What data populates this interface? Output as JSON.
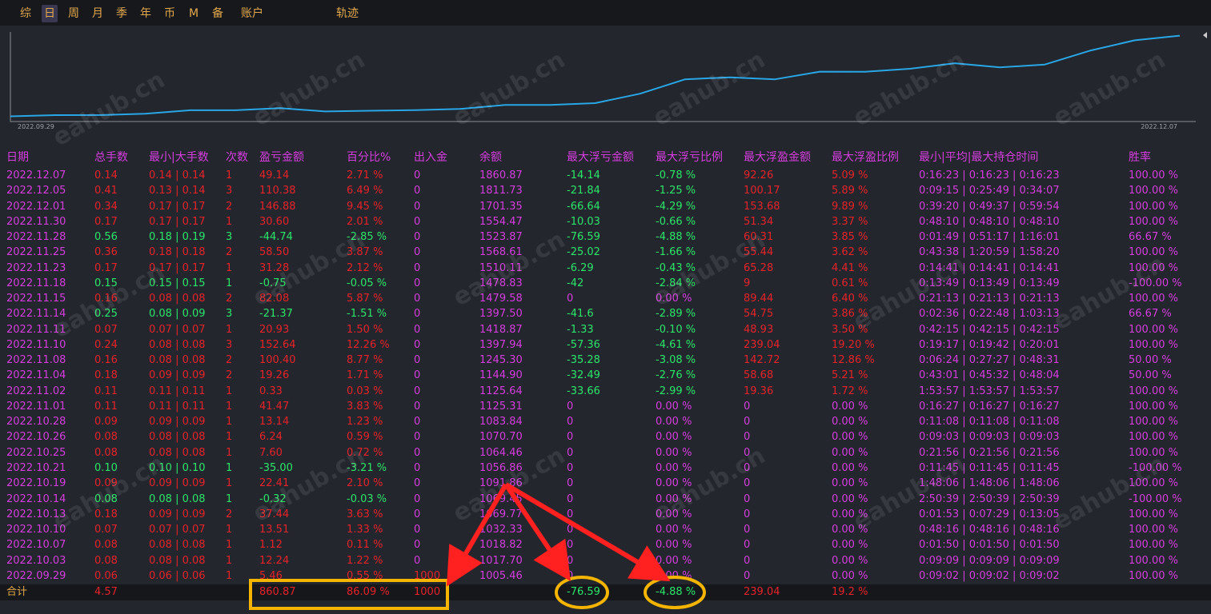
{
  "tabs": [
    "综",
    "日",
    "周",
    "月",
    "季",
    "年",
    "币",
    "M",
    "备",
    "账户",
    "轨迹"
  ],
  "active_tab": "日",
  "colors": {
    "background": "#23262c",
    "line": "#29a6e6",
    "magenta": "#d63de0",
    "red": "#e8222a",
    "green": "#2ce66b",
    "orange": "#e3a94d",
    "annotation": "#f5b400",
    "arrow": "#ff2020"
  },
  "equity_chart": {
    "type": "line",
    "x_start_label": "2022.09.29",
    "x_end_label": "2022.12.07",
    "x": [
      "2022.09.29",
      "2022.10.03",
      "2022.10.07",
      "2022.10.10",
      "2022.10.13",
      "2022.10.14",
      "2022.10.19",
      "2022.10.21",
      "2022.10.25",
      "2022.10.26",
      "2022.10.28",
      "2022.11.01",
      "2022.11.02",
      "2022.11.04",
      "2022.11.08",
      "2022.11.10",
      "2022.11.11",
      "2022.11.14",
      "2022.11.15",
      "2022.11.18",
      "2022.11.23",
      "2022.11.25",
      "2022.11.28",
      "2022.11.30",
      "2022.12.01",
      "2022.12.05",
      "2022.12.07"
    ],
    "values": [
      1005.46,
      1017.7,
      1018.82,
      1032.33,
      1069.77,
      1069.45,
      1091.86,
      1056.86,
      1064.46,
      1070.7,
      1083.84,
      1125.31,
      1125.64,
      1144.9,
      1245.3,
      1397.94,
      1418.87,
      1397.5,
      1479.58,
      1478.83,
      1510.11,
      1568.61,
      1523.87,
      1554.47,
      1701.35,
      1811.73,
      1860.87
    ],
    "ylim": [
      950,
      1900
    ]
  },
  "headers": [
    "日期",
    "总手数",
    "最小|大手数",
    "次数",
    "盈亏金额",
    "百分比%",
    "出入金",
    "余额",
    "最大浮亏金额",
    "最大浮亏比例",
    "最大浮盈金额",
    "最大浮盈比例",
    "最小|平均|最大持仓时间",
    "胜率"
  ],
  "rows": [
    [
      "2022.12.07",
      "0.14",
      "0.14 | 0.14",
      "1",
      "49.14",
      "2.71 %",
      "0",
      "1860.87",
      "-14.14",
      "-0.78 %",
      "92.26",
      "5.09 %",
      "0:16:23 | 0:16:23 | 0:16:23",
      "100.00 %"
    ],
    [
      "2022.12.05",
      "0.41",
      "0.13 | 0.14",
      "3",
      "110.38",
      "6.49 %",
      "0",
      "1811.73",
      "-21.84",
      "-1.25 %",
      "100.17",
      "5.89 %",
      "0:09:15 | 0:25:49 | 0:34:07",
      "100.00 %"
    ],
    [
      "2022.12.01",
      "0.34",
      "0.17 | 0.17",
      "2",
      "146.88",
      "9.45 %",
      "0",
      "1701.35",
      "-66.64",
      "-4.29 %",
      "153.68",
      "9.89 %",
      "0:39:20 | 0:49:37 | 0:59:54",
      "100.00 %"
    ],
    [
      "2022.11.30",
      "0.17",
      "0.17 | 0.17",
      "1",
      "30.60",
      "2.01 %",
      "0",
      "1554.47",
      "-10.03",
      "-0.66 %",
      "51.34",
      "3.37 %",
      "0:48:10 | 0:48:10 | 0:48:10",
      "100.00 %"
    ],
    [
      "2022.11.28",
      "0.56",
      "0.18 | 0.19",
      "3",
      "-44.74",
      "-2.85 %",
      "0",
      "1523.87",
      "-76.59",
      "-4.88 %",
      "60.31",
      "3.85 %",
      "0:01:49 | 0:51:17 | 1:16:01",
      "66.67 %"
    ],
    [
      "2022.11.25",
      "0.36",
      "0.18 | 0.18",
      "2",
      "58.50",
      "3.87 %",
      "0",
      "1568.61",
      "-25.02",
      "-1.66 %",
      "55.44",
      "3.62 %",
      "0:43:38 | 1:20:59 | 1:58:20",
      "100.00 %"
    ],
    [
      "2022.11.23",
      "0.17",
      "0.17 | 0.17",
      "1",
      "31.28",
      "2.12 %",
      "0",
      "1510.11",
      "-6.29",
      "-0.43 %",
      "65.28",
      "4.41 %",
      "0:14:41 | 0:14:41 | 0:14:41",
      "100.00 %"
    ],
    [
      "2022.11.18",
      "0.15",
      "0.15 | 0.15",
      "1",
      "-0.75",
      "-0.05 %",
      "0",
      "1478.83",
      "-42",
      "-2.84 %",
      "9",
      "0.61 %",
      "0:13:49 | 0:13:49 | 0:13:49",
      "-100.00 %"
    ],
    [
      "2022.11.15",
      "0.16",
      "0.08 | 0.08",
      "2",
      "82.08",
      "5.87 %",
      "0",
      "1479.58",
      "0",
      "0.00 %",
      "89.44",
      "6.40 %",
      "0:21:13 | 0:21:13 | 0:21:13",
      "100.00 %"
    ],
    [
      "2022.11.14",
      "0.25",
      "0.08 | 0.09",
      "3",
      "-21.37",
      "-1.51 %",
      "0",
      "1397.50",
      "-41.6",
      "-2.89 %",
      "54.75",
      "3.86 %",
      "0:02:36 | 0:22:48 | 1:03:13",
      "66.67 %"
    ],
    [
      "2022.11.11",
      "0.07",
      "0.07 | 0.07",
      "1",
      "20.93",
      "1.50 %",
      "0",
      "1418.87",
      "-1.33",
      "-0.10 %",
      "48.93",
      "3.50 %",
      "0:42:15 | 0:42:15 | 0:42:15",
      "100.00 %"
    ],
    [
      "2022.11.10",
      "0.24",
      "0.08 | 0.08",
      "3",
      "152.64",
      "12.26 %",
      "0",
      "1397.94",
      "-57.36",
      "-4.61 %",
      "239.04",
      "19.20 %",
      "0:19:17 | 0:19:42 | 0:20:01",
      "100.00 %"
    ],
    [
      "2022.11.08",
      "0.16",
      "0.08 | 0.08",
      "2",
      "100.40",
      "8.77 %",
      "0",
      "1245.30",
      "-35.28",
      "-3.08 %",
      "142.72",
      "12.86 %",
      "0:06:24 | 0:27:27 | 0:48:31",
      "50.00 %"
    ],
    [
      "2022.11.04",
      "0.18",
      "0.09 | 0.09",
      "2",
      "19.26",
      "1.71 %",
      "0",
      "1144.90",
      "-32.49",
      "-2.76 %",
      "58.68",
      "5.21 %",
      "0:43:01 | 0:45:32 | 0:48:04",
      "50.00 %"
    ],
    [
      "2022.11.02",
      "0.11",
      "0.11 | 0.11",
      "1",
      "0.33",
      "0.03 %",
      "0",
      "1125.64",
      "-33.66",
      "-2.99 %",
      "19.36",
      "1.72 %",
      "1:53:57 | 1:53:57 | 1:53:57",
      "100.00 %"
    ],
    [
      "2022.11.01",
      "0.11",
      "0.11 | 0.11",
      "1",
      "41.47",
      "3.83 %",
      "0",
      "1125.31",
      "0",
      "0.00 %",
      "0",
      "0.00 %",
      "0:16:27 | 0:16:27 | 0:16:27",
      "100.00 %"
    ],
    [
      "2022.10.28",
      "0.09",
      "0.09 | 0.09",
      "1",
      "13.14",
      "1.23 %",
      "0",
      "1083.84",
      "0",
      "0.00 %",
      "0",
      "0.00 %",
      "0:11:08 | 0:11:08 | 0:11:08",
      "100.00 %"
    ],
    [
      "2022.10.26",
      "0.08",
      "0.08 | 0.08",
      "1",
      "6.24",
      "0.59 %",
      "0",
      "1070.70",
      "0",
      "0.00 %",
      "0",
      "0.00 %",
      "0:09:03 | 0:09:03 | 0:09:03",
      "100.00 %"
    ],
    [
      "2022.10.25",
      "0.08",
      "0.08 | 0.08",
      "1",
      "7.60",
      "0.72 %",
      "0",
      "1064.46",
      "0",
      "0.00 %",
      "0",
      "0.00 %",
      "0:21:56 | 0:21:56 | 0:21:56",
      "100.00 %"
    ],
    [
      "2022.10.21",
      "0.10",
      "0.10 | 0.10",
      "1",
      "-35.00",
      "-3.21 %",
      "0",
      "1056.86",
      "0",
      "0.00 %",
      "0",
      "0.00 %",
      "0:11:45 | 0:11:45 | 0:11:45",
      "-100.00 %"
    ],
    [
      "2022.10.19",
      "0.09",
      "0.09 | 0.09",
      "1",
      "22.41",
      "2.10 %",
      "0",
      "1091.86",
      "0",
      "0.00 %",
      "0",
      "0.00 %",
      "1:48:06 | 1:48:06 | 1:48:06",
      "100.00 %"
    ],
    [
      "2022.10.14",
      "0.08",
      "0.08 | 0.08",
      "1",
      "-0.32",
      "-0.03 %",
      "0",
      "1069.45",
      "0",
      "0.00 %",
      "0",
      "0.00 %",
      "2:50:39 | 2:50:39 | 2:50:39",
      "-100.00 %"
    ],
    [
      "2022.10.13",
      "0.18",
      "0.09 | 0.09",
      "2",
      "37.44",
      "3.63 %",
      "0",
      "1069.77",
      "0",
      "0.00 %",
      "0",
      "0.00 %",
      "0:01:53 | 0:07:29 | 0:13:05",
      "100.00 %"
    ],
    [
      "2022.10.10",
      "0.07",
      "0.07 | 0.07",
      "1",
      "13.51",
      "1.33 %",
      "0",
      "1032.33",
      "0",
      "0.00 %",
      "0",
      "0.00 %",
      "0:48:16 | 0:48:16 | 0:48:16",
      "100.00 %"
    ],
    [
      "2022.10.07",
      "0.08",
      "0.08 | 0.08",
      "1",
      "1.12",
      "0.11 %",
      "0",
      "1018.82",
      "0",
      "0.00 %",
      "0",
      "0.00 %",
      "0:01:50 | 0:01:50 | 0:01:50",
      "100.00 %"
    ],
    [
      "2022.10.03",
      "0.08",
      "0.08 | 0.08",
      "1",
      "12.24",
      "1.22 %",
      "0",
      "1017.70",
      "0",
      "0.00 %",
      "0",
      "0.00 %",
      "0:09:09 | 0:09:09 | 0:09:09",
      "100.00 %"
    ],
    [
      "2022.09.29",
      "0.06",
      "0.06 | 0.06",
      "1",
      "5.46",
      "0.55 %",
      "1000",
      "1005.46",
      "0",
      "0.00 %",
      "0",
      "0.00 %",
      "0:09:02 | 0:09:02 | 0:09:02",
      "100.00 %"
    ]
  ],
  "total": {
    "label": "合计",
    "lots": "4.57",
    "pnl": "860.87",
    "pct": "86.09 %",
    "deposit": "1000",
    "max_float_loss": "-76.59",
    "max_float_loss_pct": "-4.88 %",
    "max_float_profit": "239.04",
    "max_float_profit_pct": "19.2 %"
  },
  "watermark": "eahub.cn"
}
